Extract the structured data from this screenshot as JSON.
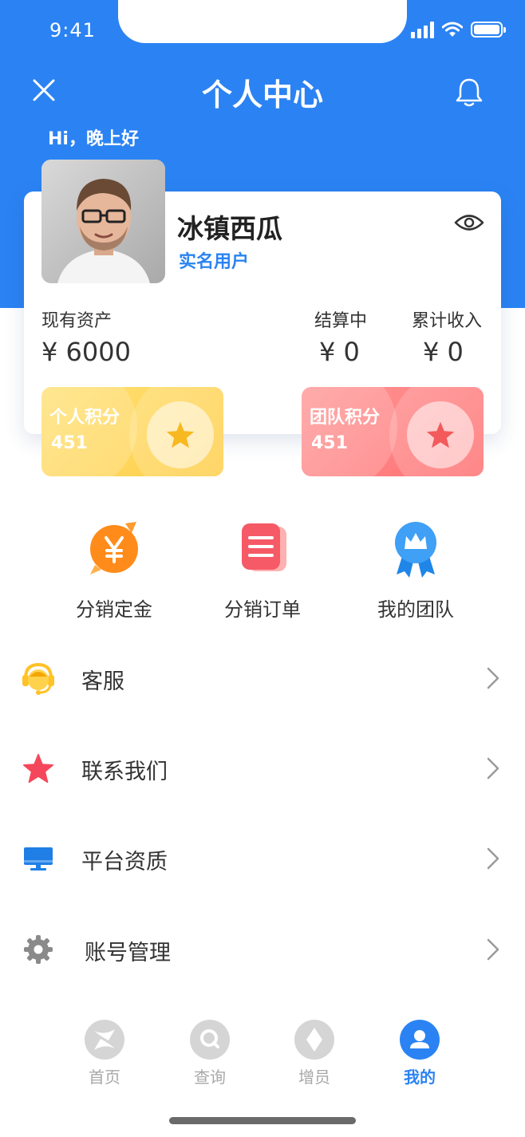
{
  "status_bar": {
    "time": "9:41"
  },
  "header": {
    "title": "个人中心",
    "greeting": "Hi，晚上好"
  },
  "profile": {
    "name": "冰镇西瓜",
    "verification": "实名用户"
  },
  "assets": {
    "current": {
      "label": "现有资产",
      "value": "¥ 6000"
    },
    "settling": {
      "label": "结算中",
      "value": "¥ 0"
    },
    "total": {
      "label": "累计收入",
      "value": "¥ 0"
    }
  },
  "points": {
    "personal": {
      "label": "个人积分",
      "value": "451"
    },
    "team": {
      "label": "团队积分",
      "value": "451"
    }
  },
  "shortcuts": [
    {
      "label": "分销定金",
      "icon": "yen-coin-icon"
    },
    {
      "label": "分销订单",
      "icon": "order-list-icon"
    },
    {
      "label": "我的团队",
      "icon": "team-badge-icon"
    }
  ],
  "menu": [
    {
      "label": "客服",
      "icon": "customer-service-icon"
    },
    {
      "label": "联系我们",
      "icon": "star-icon"
    },
    {
      "label": "平台资质",
      "icon": "monitor-icon"
    },
    {
      "label": "账号管理",
      "icon": "gear-icon"
    }
  ],
  "tabs": [
    {
      "label": "首页",
      "icon": "home-icon"
    },
    {
      "label": "查询",
      "icon": "search-icon"
    },
    {
      "label": "增员",
      "icon": "diamond-icon"
    },
    {
      "label": "我的",
      "icon": "user-icon"
    }
  ],
  "colors": {
    "brand_blue": "#2b83f3",
    "points_yellow": "#ffcd45",
    "points_red": "#ff6d6e"
  }
}
